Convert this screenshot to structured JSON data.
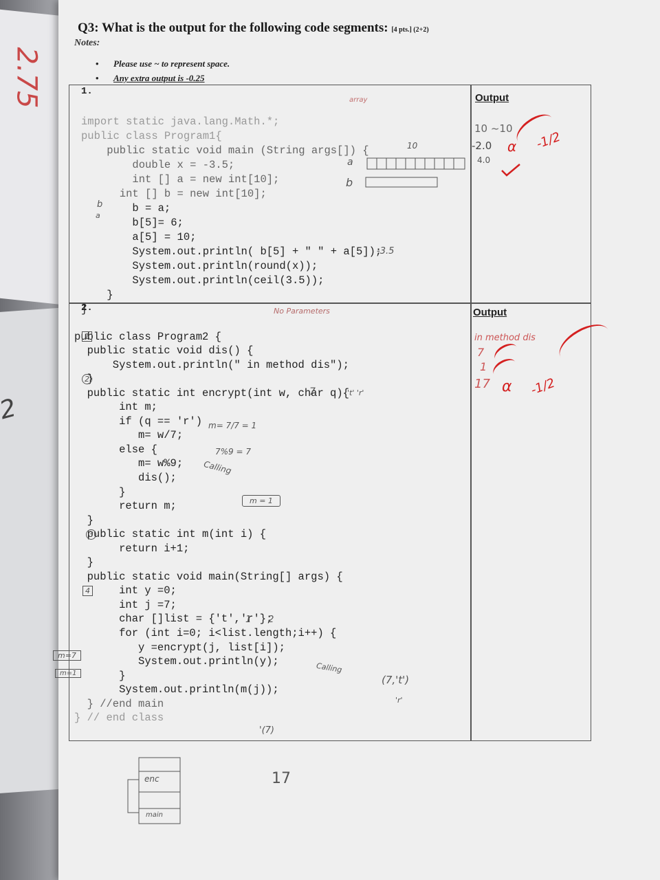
{
  "question": {
    "title": "Q3: What is the output for the following code segments:",
    "points": "[4 pts.] (2+2)",
    "notes_label": "Notes:",
    "notes": [
      "Please use ~ to represent space.",
      "Any extra output is -0.25"
    ]
  },
  "part1": {
    "number": "1.",
    "output_label": "Output",
    "code_lines": [
      "import static java.lang.Math.*;",
      "public class Program1{",
      "    public static void main (String args[]) {",
      "        double x = -3.5;",
      "        int [] a = new int[10];",
      "      int [] b = new int[10];",
      "        b = a;",
      "        b[5]= 6;",
      "        a[5] = 10;",
      "        System.out.println( b[5] + \" \" + a[5]);",
      "        System.out.println(round(x));",
      "        System.out.println(ceil(3.5));",
      "    }",
      "}"
    ],
    "written_answers": [
      "10 ~10",
      "-2.0",
      "4.0"
    ],
    "annotations": {
      "array_note": "array",
      "size_note": "10",
      "arr_a": "a",
      "arr_b": "b",
      "round_result": "-3.5",
      "margin_b": "b",
      "margin_a": "a"
    },
    "grading": {
      "mark_wrong": "α",
      "half_deduction": "-1/2"
    }
  },
  "part2": {
    "number": "2.",
    "output_label": "Output",
    "code_lines": [
      "public class Program2 {",
      "  public static void dis() {",
      "      System.out.println(\" in method dis\");",
      "  }",
      "  public static int encrypt(int w, char q){",
      "       int m;",
      "       if (q == 'r')",
      "          m= w/7;",
      "       else {",
      "          m= w%9;",
      "          dis();",
      "       }",
      "       return m;",
      "  }",
      "",
      "  public static int m(int i) {",
      "       return i+1;",
      "  }",
      "",
      "  public static void main(String[] args) {",
      "       int y =0;",
      "       int j =7;",
      "       char []list = {'t','r'};",
      "       for (int i=0; i<list.length;i++) {",
      "          y =encrypt(j, list[i]);",
      "          System.out.println(y);",
      "       }",
      "       System.out.println(m(j));",
      "  } //end main",
      "} // end class"
    ],
    "written_answers": [
      "in method dis",
      "7",
      "1",
      "17"
    ],
    "annotations": {
      "no_params": "No Parameters",
      "step1": "1",
      "step2": "2",
      "step3": "3",
      "step4": "4",
      "seven": "7",
      "t_r": "'t' 'r'",
      "calc1": "m= 7/7 = 1",
      "calc2": "7%9 = 7",
      "calling": "Calling",
      "m_eq_1": "m = 1",
      "loop_idx": "1      2",
      "calling2": "Calling",
      "args_note": "(7,'t')",
      "args_note2": "'r'",
      "m7_call": "'(7)",
      "left_m7": "m=7",
      "left_m1": "m=1",
      "big17": "17",
      "stack_top": "enc",
      "stack_bottom": "main"
    },
    "grading": {
      "mark_wrong": "α",
      "half_deduction": "-1/2"
    }
  },
  "margin": {
    "score_top": "2.75",
    "score_mid": "2"
  }
}
